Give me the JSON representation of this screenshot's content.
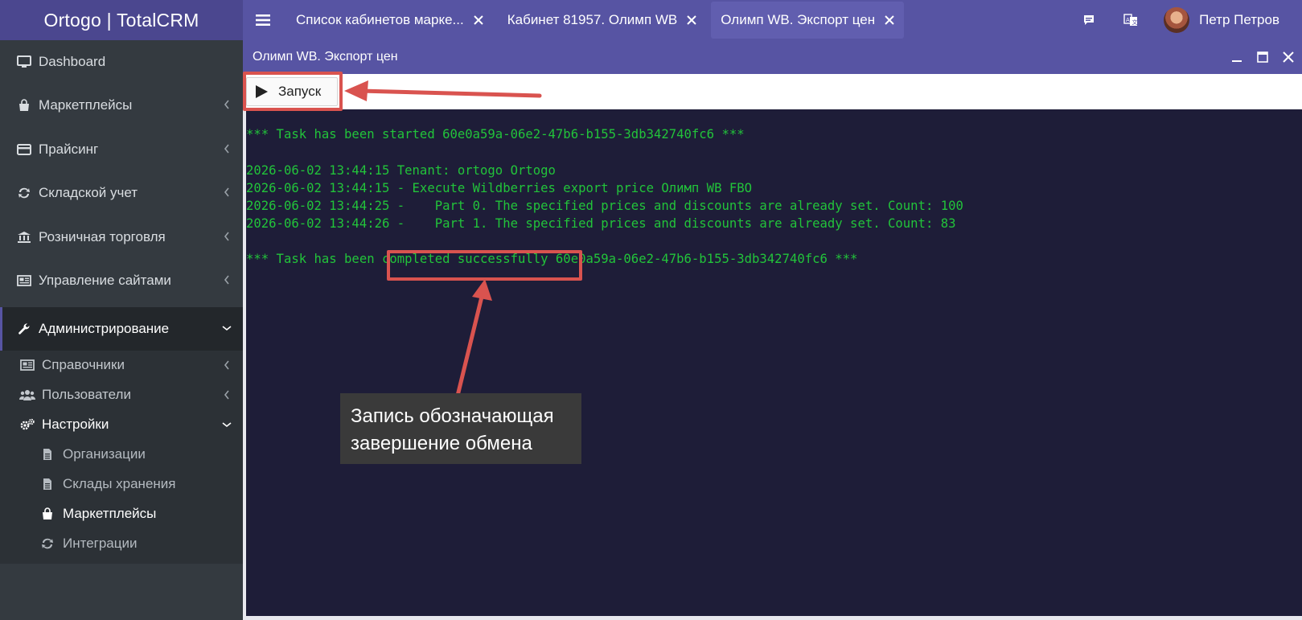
{
  "app": {
    "brand": "Ortogo | TotalCRM"
  },
  "tabs": [
    {
      "label": "Список кабинетов марке...",
      "active": false
    },
    {
      "label": "Кабинет 81957. Олимп WB",
      "active": false
    },
    {
      "label": "Олимп WB. Экспорт цен",
      "active": true
    }
  ],
  "user": {
    "name": "Петр Петров"
  },
  "sidebar": {
    "items": [
      {
        "label": "Dashboard",
        "icon": "monitor-icon"
      },
      {
        "label": "Маркетплейсы",
        "icon": "bag-icon"
      },
      {
        "label": "Прайсинг",
        "icon": "card-icon"
      },
      {
        "label": "Складской учет",
        "icon": "exchange-icon"
      },
      {
        "label": "Розничная торговля",
        "icon": "bank-icon"
      },
      {
        "label": "Управление сайтами",
        "icon": "newspaper-icon"
      },
      {
        "label": "Администрирование",
        "icon": "wrench-icon",
        "active": true
      }
    ],
    "admin_sub": [
      {
        "label": "Справочники",
        "icon": "newspaper-icon"
      },
      {
        "label": "Пользователи",
        "icon": "users-icon"
      },
      {
        "label": "Настройки",
        "icon": "gears-icon",
        "open": true
      }
    ],
    "settings_sub": [
      {
        "label": "Организации",
        "icon": "file-icon"
      },
      {
        "label": "Склады хранения",
        "icon": "file-icon"
      },
      {
        "label": "Маркетплейсы",
        "icon": "bag-icon",
        "current": true
      },
      {
        "label": "Интеграции",
        "icon": "exchange-icon"
      }
    ]
  },
  "window": {
    "title": "Олимп WB. Экспорт цен",
    "run_label": "Запуск"
  },
  "console": {
    "lines": [
      "*** Task has been started 60e0a59a-06e2-47b6-b155-3db342740fc6 ***",
      "2026-06-02 13:44:15 Tenant: ortogo Ortogo",
      "2026-06-02 13:44:15 - Execute Wildberries export price Олимп WB FBO",
      "2026-06-02 13:44:25 -    Part 0. The specified prices and discounts are already set. Count: 100",
      "2026-06-02 13:44:26 -    Part 1. The specified prices and discounts are already set. Count: 83",
      "*** Task has been completed successfully 60e0a59a-06e2-47b6-b155-3db342740fc6 ***"
    ]
  },
  "annotation": {
    "line1": "Запись обозначающая",
    "line2": "завершение обмена"
  },
  "colors": {
    "accent": "#5754a3",
    "console_bg": "#1e1d38",
    "console_text": "#22c33a",
    "highlight": "#d9534f"
  }
}
